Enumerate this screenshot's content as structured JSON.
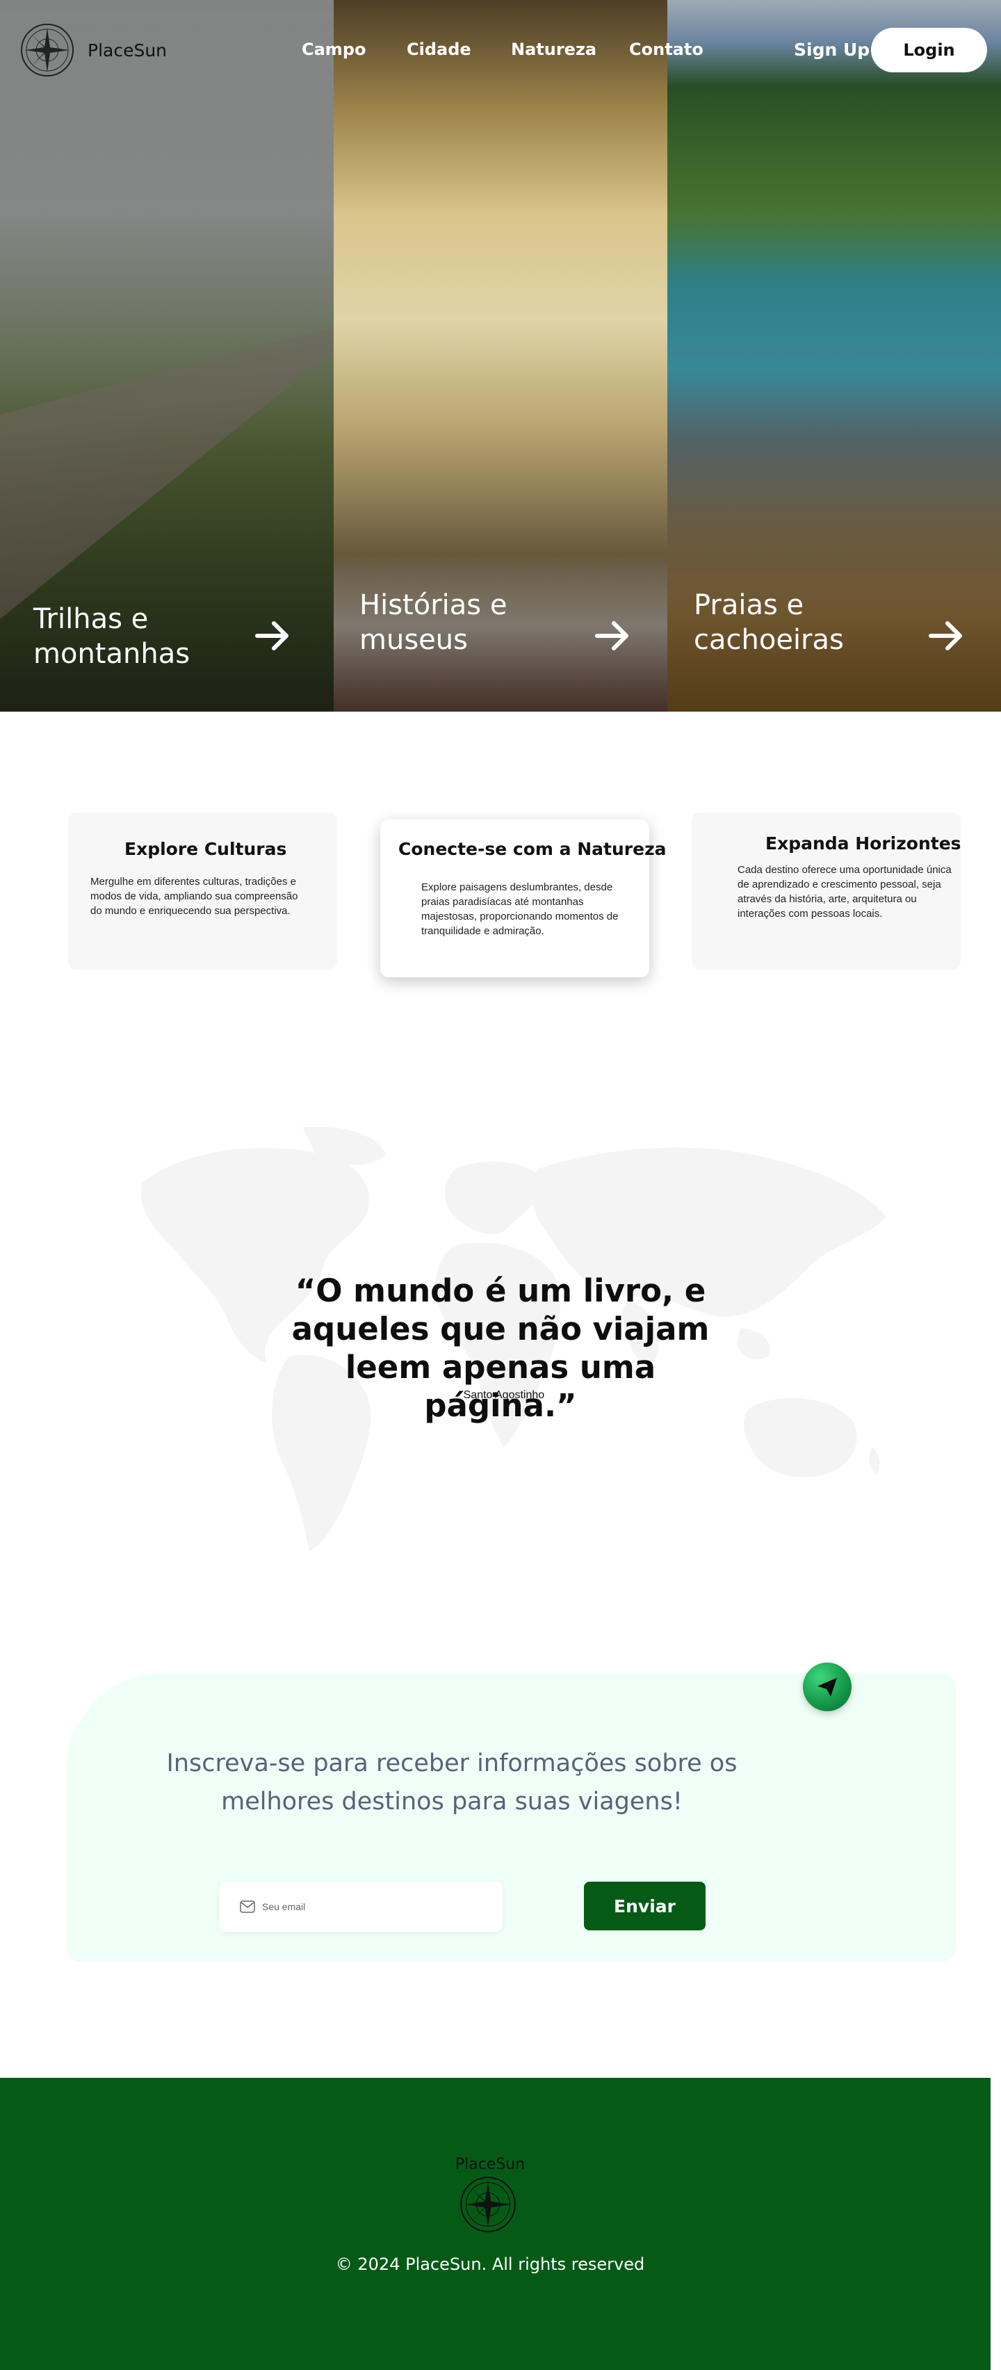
{
  "nav": {
    "brand": "PlaceSun",
    "links": [
      "Campo",
      "Cidade",
      "Natureza",
      "Contato"
    ],
    "signup": "Sign Up",
    "login": "Login"
  },
  "hero": {
    "panels": [
      {
        "title": "Trilhas e\nmontanhas",
        "icon": "arrow-right-icon"
      },
      {
        "title": "Histórias e\nmuseus",
        "icon": "arrow-right-icon"
      },
      {
        "title": "Praias e\ncachoeiras",
        "icon": "arrow-right-icon"
      }
    ]
  },
  "features": [
    {
      "title": "Explore Culturas",
      "text": "Mergulhe em diferentes culturas, tradições e modos de vida, ampliando sua compreensão do mundo e enriquecendo sua perspectiva."
    },
    {
      "title": "Conecte-se com a Natureza",
      "text": "Explore paisagens deslumbrantes, desde praias paradisíacas até montanhas majestosas, proporcionando momentos de tranquilidade e admiração."
    },
    {
      "title": "Expanda Horizontes",
      "text": "Cada destino oferece uma oportunidade única de aprendizado e crescimento pessoal, seja através da história, arte, arquitetura ou interações com pessoas locais."
    }
  ],
  "quote": {
    "text": "“O mundo é um livro, e aqueles que não viajam leem apenas uma página.”",
    "author": "- Santo Agostinho"
  },
  "newsletter": {
    "title": "Inscreva-se para receber informações sobre os melhores destinos para suas viagens!",
    "email_placeholder": "Seu email",
    "submit": "Enviar",
    "icon": "paper-plane-icon"
  },
  "footer": {
    "brand": "PlaceSun",
    "copyright": "© 2024 PlaceSun. All rights reserved"
  },
  "colors": {
    "brand_green": "#055b16",
    "newsletter_bg": "#effff8",
    "newsletter_text": "#5a6178",
    "plane_button": "#159a4a"
  }
}
